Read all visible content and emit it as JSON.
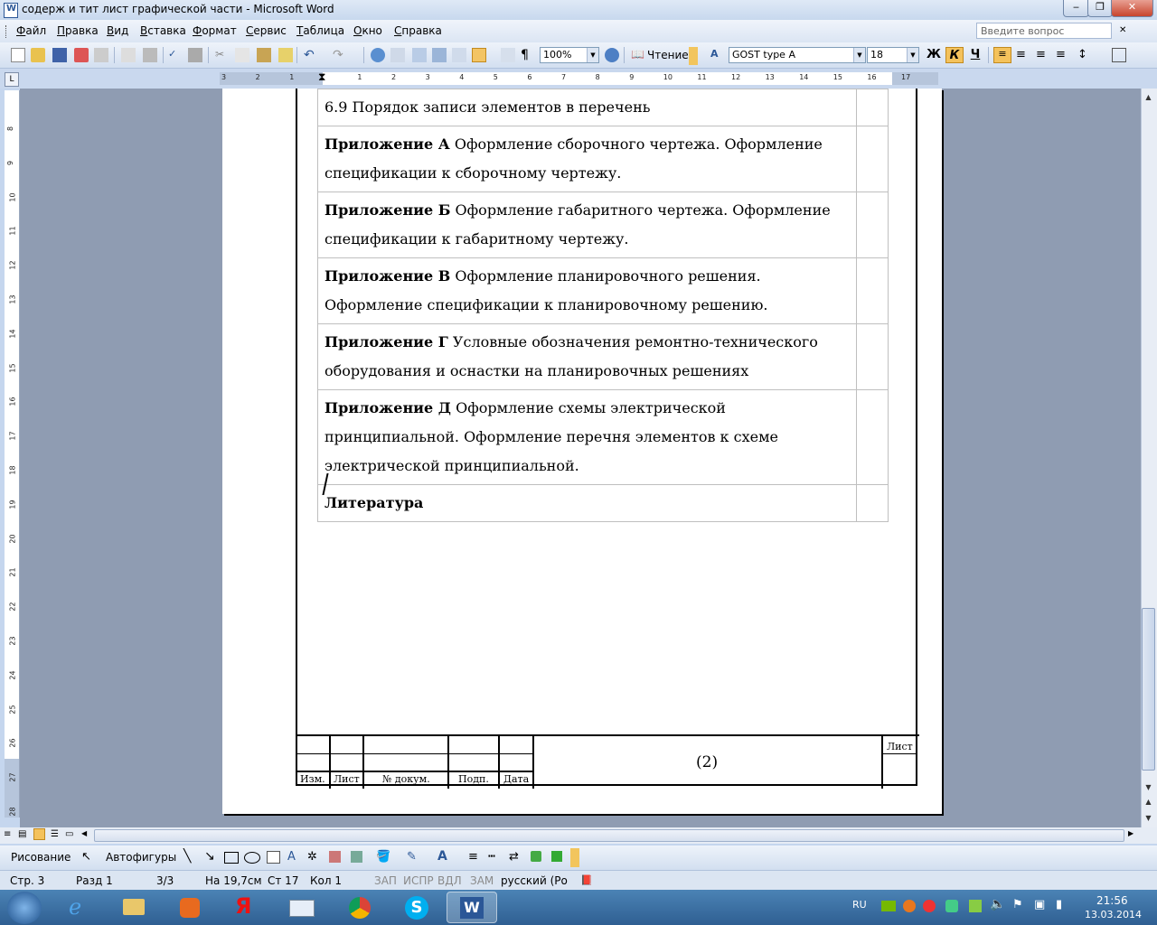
{
  "window": {
    "title": "содерж и тит лист графической части - Microsoft Word",
    "minimize": "‒",
    "maximize": "❐",
    "close": "✕"
  },
  "menu": {
    "items": [
      "Файл",
      "Правка",
      "Вид",
      "Вставка",
      "Формат",
      "Сервис",
      "Таблица",
      "Окно",
      "Справка"
    ],
    "help_placeholder": "Введите вопрос"
  },
  "toolbar": {
    "zoom": "100%",
    "read_label": "Чтение",
    "style_name": "GOST type A",
    "font_size": "18",
    "bold": "Ж",
    "italic": "К",
    "underline": "Ч",
    "pilcrow": "¶"
  },
  "ruler": {
    "corner": "L",
    "h_numbers": [
      "3",
      "2",
      "1",
      "",
      "1",
      "2",
      "3",
      "4",
      "5",
      "6",
      "7",
      "8",
      "9",
      "10",
      "11",
      "12",
      "13",
      "14",
      "15",
      "16",
      "17"
    ],
    "v_numbers": [
      "8",
      "9",
      "10",
      "11",
      "12",
      "13",
      "14",
      "15",
      "16",
      "17",
      "18",
      "19",
      "20",
      "21",
      "22",
      "23",
      "24",
      "25",
      "26",
      "27",
      "28"
    ]
  },
  "document": {
    "toc_rows": [
      {
        "bold": "",
        "text": "6.9 Порядок записи элементов в перечень"
      },
      {
        "bold": "Приложение А",
        "text": " Оформление сборочного чертежа. Оформление спецификации к сборочному чертежу."
      },
      {
        "bold": "Приложение Б",
        "text": " Оформление габаритного чертежа. Оформление спецификации к габаритному чертежу."
      },
      {
        "bold": "Приложение В",
        "text": " Оформление планировочного решения. Оформление спецификации к планировочному решению."
      },
      {
        "bold": "Приложение Г",
        "text": " Условные обозначения ремонтно-технического оборудования и оснастки на планировочных решениях"
      },
      {
        "bold": "Приложение Д",
        "text": " Оформление схемы электрической принципиальной. Оформление перечня элементов к схеме электрической принципиальной."
      },
      {
        "bold": "Литература",
        "text": ""
      }
    ],
    "stamp": {
      "izm": "Изм.",
      "list": "Лист",
      "doc_no": "№ докум.",
      "sign": "Подп.",
      "date": "Дата",
      "list_right": "Лист",
      "code": "(2)"
    }
  },
  "drawbar": {
    "drawing": "Рисование",
    "autoshapes": "Автофигуры"
  },
  "status": {
    "page": "Стр. 3",
    "section": "Разд 1",
    "pages": "3/3",
    "at": "На 19,7см",
    "line": "Ст 17",
    "col": "Кол 1",
    "rec": "ЗАП",
    "trk": "ИСПР",
    "ext": "ВДЛ",
    "ovr": "ЗАМ",
    "lang": "русский (Ро"
  },
  "taskbar": {
    "lang": "RU",
    "time": "21:56",
    "date": "13.03.2014"
  }
}
